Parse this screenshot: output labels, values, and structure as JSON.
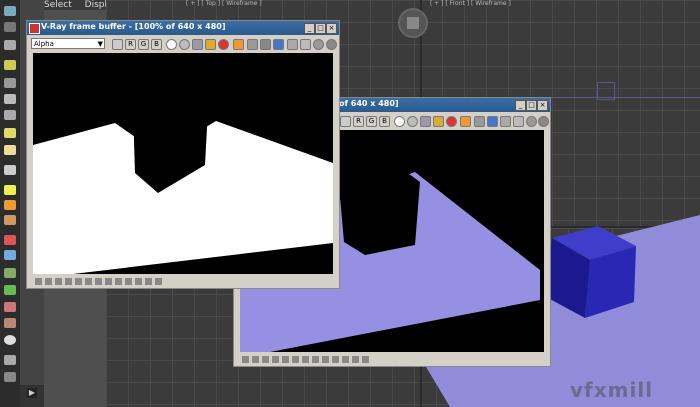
{
  "menu": {
    "select_label": "Select",
    "display_label": "Display"
  },
  "viewports": {
    "top_label": "[ + ] [ Top ] [ Wireframe ]",
    "front_label": "[ + ] [ Front ] [ Wireframe ]"
  },
  "frame_buffer_alpha": {
    "title": "V-Ray frame buffer - [100% of 640 x 480]",
    "channel": "Alpha",
    "channel_buttons": [
      "R",
      "G",
      "B"
    ]
  },
  "frame_buffer_rgb": {
    "title": "of 640 x 480]",
    "channel_buttons": [
      "R",
      "G",
      "B"
    ]
  },
  "watermark": "vfxmill",
  "colors": {
    "titlebar": "#2b5a8c",
    "plane": "#9590e2",
    "cube": "#2320a8",
    "alpha_fg": "#ffffff",
    "alpha_bg": "#000000"
  }
}
